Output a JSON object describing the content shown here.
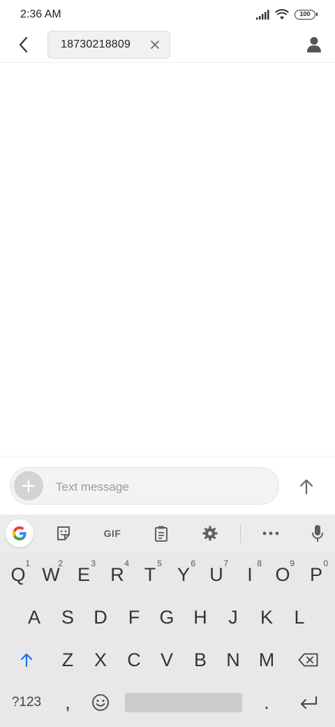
{
  "status_bar": {
    "time": "2:36 AM",
    "battery": "100",
    "icons": [
      "signal-icon",
      "wifi-icon",
      "battery-icon"
    ]
  },
  "header": {
    "back_icon": "back-chevron-icon",
    "recipient": "18730218809",
    "remove_icon": "close-icon",
    "contact_icon": "person-icon"
  },
  "composer": {
    "add_icon": "plus-icon",
    "placeholder": "Text message",
    "send_icon": "arrow-up-icon"
  },
  "keyboard": {
    "toolbar": {
      "items": [
        "google-icon",
        "sticker-icon",
        "gif",
        "clipboard-icon",
        "settings-icon",
        "more-icon",
        "mic-icon"
      ],
      "gif_label": "GIF"
    },
    "row1": [
      {
        "key": "Q",
        "hint": "1"
      },
      {
        "key": "W",
        "hint": "2"
      },
      {
        "key": "E",
        "hint": "3"
      },
      {
        "key": "R",
        "hint": "4"
      },
      {
        "key": "T",
        "hint": "5"
      },
      {
        "key": "Y",
        "hint": "6"
      },
      {
        "key": "U",
        "hint": "7"
      },
      {
        "key": "I",
        "hint": "8"
      },
      {
        "key": "O",
        "hint": "9"
      },
      {
        "key": "P",
        "hint": "0"
      }
    ],
    "row2": [
      "A",
      "S",
      "D",
      "F",
      "G",
      "H",
      "J",
      "K",
      "L"
    ],
    "row3": [
      "Z",
      "X",
      "C",
      "V",
      "B",
      "N",
      "M"
    ],
    "row4": {
      "symbols": "?123",
      "comma": ",",
      "period": "."
    },
    "colors": {
      "shift_accent": "#1a73e8",
      "background": "#e8e8e8"
    }
  }
}
